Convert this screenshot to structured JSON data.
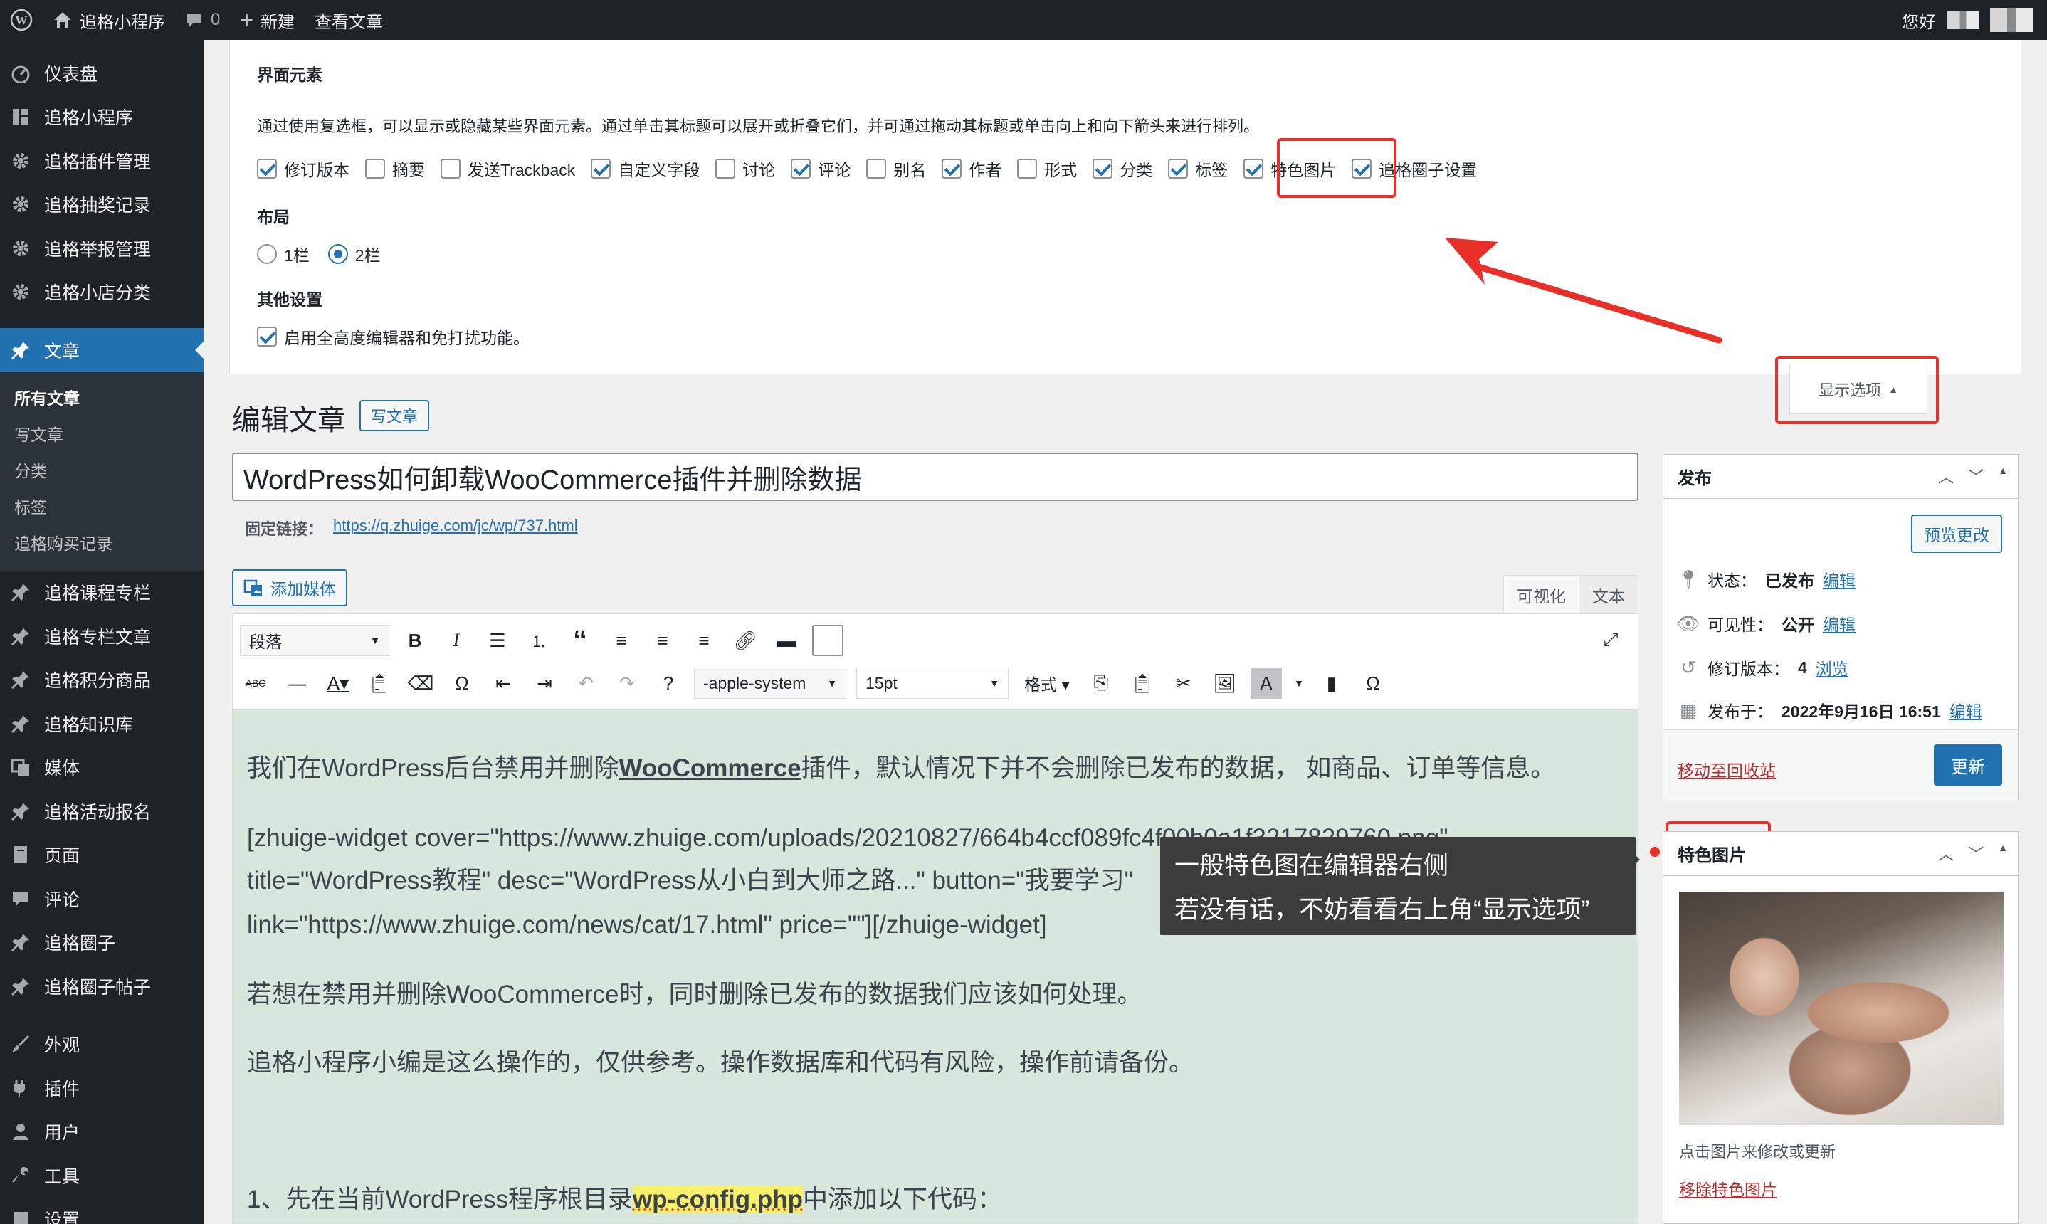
{
  "adminbar": {
    "site_name": "追格小程序",
    "comments_count": "0",
    "new_label": "新建",
    "view_post_label": "查看文章",
    "greeting": "您好"
  },
  "menu": {
    "items_top": [
      {
        "label": "仪表盘",
        "icon": "dashboard-icon"
      },
      {
        "label": "追格小程序",
        "icon": "grid-icon"
      },
      {
        "label": "追格插件管理",
        "icon": "gear-icon"
      },
      {
        "label": "追格抽奖记录",
        "icon": "gear-icon"
      },
      {
        "label": "追格举报管理",
        "icon": "gear-icon"
      },
      {
        "label": "追格小店分类",
        "icon": "gear-icon"
      }
    ],
    "current": {
      "label": "文章",
      "icon": "pin-icon"
    },
    "submenu": [
      "所有文章",
      "写文章",
      "分类",
      "标签",
      "追格购买记录"
    ],
    "items_mid": [
      {
        "label": "追格课程专栏",
        "icon": "pin-icon"
      },
      {
        "label": "追格专栏文章",
        "icon": "pin-icon"
      },
      {
        "label": "追格积分商品",
        "icon": "pin-icon"
      },
      {
        "label": "追格知识库",
        "icon": "pin-icon"
      },
      {
        "label": "媒体",
        "icon": "media-icon"
      },
      {
        "label": "追格活动报名",
        "icon": "pin-icon"
      },
      {
        "label": "页面",
        "icon": "page-icon"
      },
      {
        "label": "评论",
        "icon": "comment-icon"
      },
      {
        "label": "追格圈子",
        "icon": "pin-icon"
      },
      {
        "label": "追格圈子帖子",
        "icon": "pin-icon"
      }
    ],
    "items_bottom": [
      {
        "label": "外观",
        "icon": "brush-icon"
      },
      {
        "label": "插件",
        "icon": "plugin-icon"
      },
      {
        "label": "用户",
        "icon": "user-icon"
      },
      {
        "label": "工具",
        "icon": "wrench-icon"
      },
      {
        "label": "设置",
        "icon": "settings-icon"
      }
    ]
  },
  "screen_options": {
    "ui_heading": "界面元素",
    "description": "通过使用复选框，可以显示或隐藏某些界面元素。通过单击其标题可以展开或折叠它们，并可通过拖动其标题或单击向上和向下箭头来进行排列。",
    "checkboxes": [
      {
        "label": "修订版本",
        "checked": true
      },
      {
        "label": "摘要",
        "checked": false
      },
      {
        "label": "发送Trackback",
        "checked": false
      },
      {
        "label": "自定义字段",
        "checked": true
      },
      {
        "label": "讨论",
        "checked": false
      },
      {
        "label": "评论",
        "checked": true
      },
      {
        "label": "别名",
        "checked": false
      },
      {
        "label": "作者",
        "checked": true
      },
      {
        "label": "形式",
        "checked": false
      },
      {
        "label": "分类",
        "checked": true
      },
      {
        "label": "标签",
        "checked": true
      },
      {
        "label": "特色图片",
        "checked": true
      },
      {
        "label": "追格圈子设置",
        "checked": true
      }
    ],
    "layout_heading": "布局",
    "layout_options": [
      {
        "label": "1栏",
        "checked": false
      },
      {
        "label": "2栏",
        "checked": true
      }
    ],
    "other_heading": "其他设置",
    "other_option": {
      "label": "启用全高度编辑器和免打扰功能。",
      "checked": true
    },
    "toggle_label": "显示选项"
  },
  "editor": {
    "page_title": "编辑文章",
    "add_new": "写文章",
    "post_title": "WordPress如何卸载WooCommerce插件并删除数据",
    "permalink_label": "固定链接：",
    "permalink_url": "https://q.zhuige.com/jc/wp/737.html",
    "add_media": "添加媒体",
    "tab_visual": "可视化",
    "tab_text": "文本",
    "format_select": "段落",
    "font_select": "-apple-system",
    "size_select": "15pt",
    "format_menu": "格式",
    "content": {
      "p1_before": "我们在WordPress后台禁用并删除",
      "p1_bold": "WooCommerce",
      "p1_after": "插件，默认情况下并不会删除已发布的数据， 如商品、订单等信息。",
      "p2_line1": "[zhuige-widget cover=\"https://www.zhuige.com/uploads/20210827/664b4ccf089fc4f00b0a1f3217829760.png\"",
      "p2_line2": "title=\"WordPress教程\" desc=\"WordPress从小白到大师之路...\" button=\"我要学习\"",
      "p2_line3": "link=\"https://www.zhuige.com/news/cat/17.html\" price=\"\"][/zhuige-widget]",
      "p3": "若想在禁用并删除WooCommerce时，同时删除已发布的数据我们应该如何处理。",
      "p4": "追格小程序小编是这么操作的，仅供参考。操作数据库和代码有风险，操作前请备份。",
      "p5_before": "1、先在当前WordPress程序根目录",
      "p5_hl": "wp-config.php",
      "p5_after": "中添加以下代码："
    }
  },
  "tooltip": {
    "line1": "一般特色图在编辑器右侧",
    "line2": "若没有话，不妨看看右上角“显示选项”"
  },
  "publish_box": {
    "title": "发布",
    "preview": "预览更改",
    "status_label": "状态：",
    "status_value": "已发布",
    "visibility_label": "可见性：",
    "visibility_value": "公开",
    "revisions_label": "修订版本：",
    "revisions_value": "4",
    "browse": "浏览",
    "published_label": "发布于：",
    "published_value": "2022年9月16日 16:51",
    "edit": "编辑",
    "trash": "移动至回收站",
    "update": "更新"
  },
  "featured_box": {
    "title": "特色图片",
    "caption": "点击图片来修改或更新",
    "remove": "移除特色图片"
  },
  "colors": {
    "accent": "#2271b1",
    "annotation_red": "#e8302b",
    "menu_bg": "#1d2327",
    "editor_bg": "#d8e7de"
  }
}
